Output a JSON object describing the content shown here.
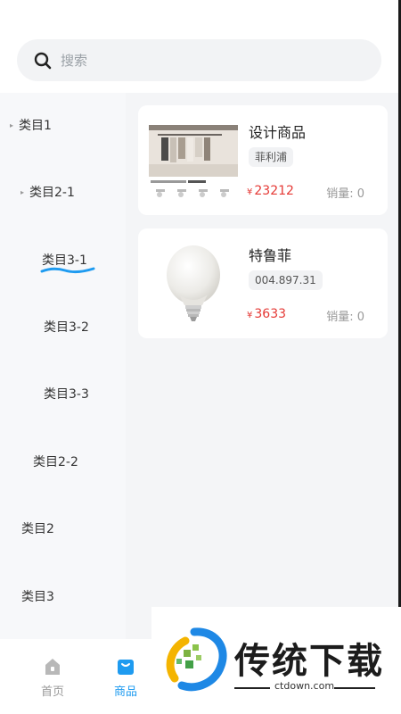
{
  "search": {
    "placeholder": "搜索",
    "icon": "search-icon"
  },
  "sidebar": {
    "items": [
      {
        "label": "类目1",
        "level": 1,
        "expanded": true
      },
      {
        "label": "类目2-1",
        "level": 2,
        "expanded": true
      },
      {
        "label": "类目3-1",
        "level": 3,
        "selected": true
      },
      {
        "label": "类目3-2",
        "level": 3
      },
      {
        "label": "类目3-3",
        "level": 3
      },
      {
        "label": "类目2-2",
        "level": 2
      },
      {
        "label": "类目2",
        "level": 1
      },
      {
        "label": "类目3",
        "level": 1
      }
    ]
  },
  "products": [
    {
      "title": "设计商品",
      "tag": "菲利浦",
      "price_symbol": "¥",
      "price": "23212",
      "sales": "销量: 0",
      "image": "closet-track-light-image"
    },
    {
      "title": "特鲁菲",
      "tag": "004.897.31",
      "price_symbol": "¥",
      "price": "3633",
      "sales": "销量: 0",
      "image": "light-bulb-image"
    }
  ],
  "tabbar": {
    "tabs": [
      {
        "label": "首页",
        "icon": "home-icon",
        "active": false
      },
      {
        "label": "商品",
        "icon": "bag-icon",
        "active": true
      }
    ]
  },
  "watermark": {
    "text": "传统下载",
    "url": "ctdown.com"
  },
  "colors": {
    "accent": "#1e9bf0",
    "price": "#e53935",
    "inactive": "#999999"
  }
}
